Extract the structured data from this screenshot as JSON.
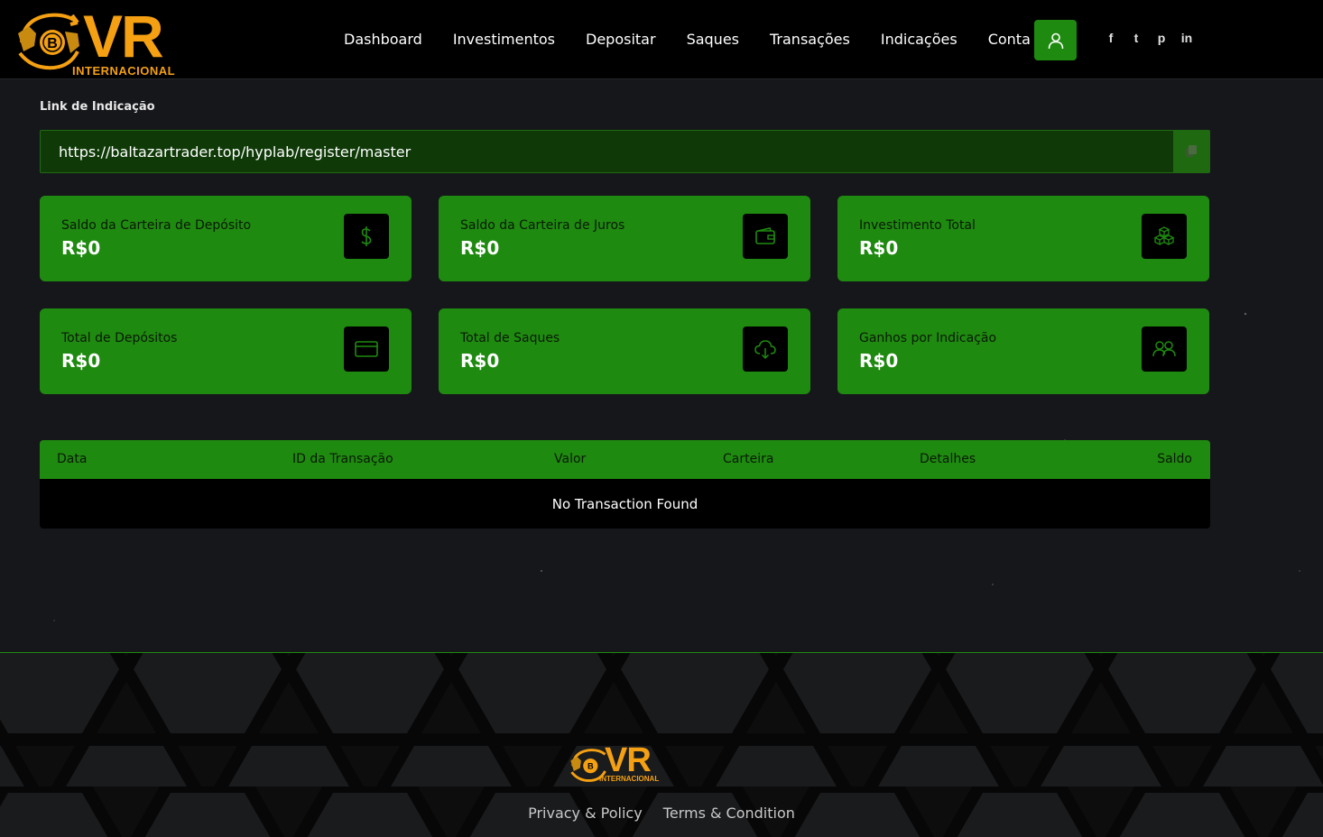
{
  "brand": {
    "logo_main": "VR",
    "logo_sub": "INTERNACIONAL",
    "primary_color": "#1f8a10",
    "accent_color": "#f4a012"
  },
  "nav": {
    "items": [
      "Dashboard",
      "Investimentos",
      "Depositar",
      "Saques",
      "Transações",
      "Indicações",
      "Conta"
    ]
  },
  "social": {
    "icons": [
      "facebook-icon",
      "twitter-icon",
      "pinterest-icon",
      "linkedin-icon"
    ],
    "glyphs": [
      "f",
      "t",
      "p",
      "in"
    ]
  },
  "referral": {
    "label": "Link de Indicação",
    "url": "https://baltazartrader.top/hyplab/register/master"
  },
  "stats": [
    {
      "title": "Saldo da Carteira de Depósito",
      "value": "R$0",
      "icon": "dollar-icon"
    },
    {
      "title": "Saldo da Carteira de Juros",
      "value": "R$0",
      "icon": "wallet-icon"
    },
    {
      "title": "Investimento Total",
      "value": "R$0",
      "icon": "cubes-icon"
    },
    {
      "title": "Total de Depósitos",
      "value": "R$0",
      "icon": "credit-card-icon"
    },
    {
      "title": "Total de Saques",
      "value": "R$0",
      "icon": "cloud-download-icon"
    },
    {
      "title": "Ganhos por Indicação",
      "value": "R$0",
      "icon": "users-icon"
    }
  ],
  "transactions": {
    "columns": [
      "Data",
      "ID da Transação",
      "Valor",
      "Carteira",
      "Detalhes",
      "Saldo"
    ],
    "empty_message": "No Transaction Found"
  },
  "footer": {
    "links": [
      "Privacy & Policy",
      "Terms & Condition"
    ]
  }
}
